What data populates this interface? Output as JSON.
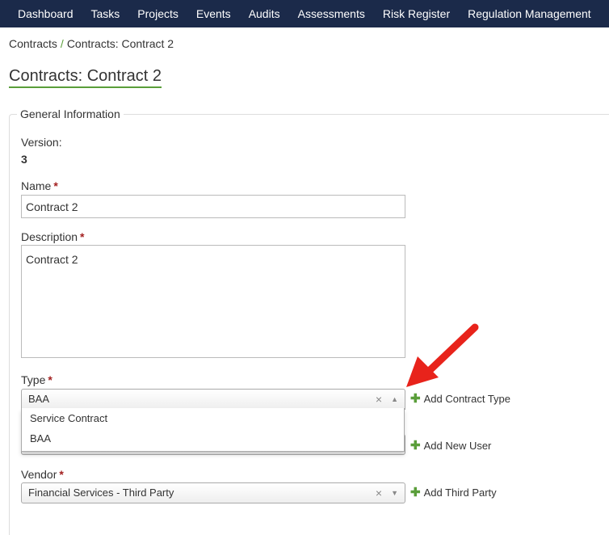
{
  "nav": {
    "items": [
      "Dashboard",
      "Tasks",
      "Projects",
      "Events",
      "Audits",
      "Assessments",
      "Risk Register",
      "Regulation Management"
    ]
  },
  "breadcrumb": {
    "root": "Contracts",
    "separator": "/",
    "current": "Contracts: Contract 2"
  },
  "page": {
    "title": "Contracts: Contract 2"
  },
  "section": {
    "legend": "General Information"
  },
  "version": {
    "label": "Version:",
    "value": "3"
  },
  "name": {
    "label": "Name",
    "value": "Contract 2",
    "required": "*"
  },
  "description": {
    "label": "Description",
    "value": "Contract 2",
    "required": "*"
  },
  "type": {
    "label": "Type",
    "required": "*",
    "selected": "BAA",
    "options": [
      "Service Contract",
      "BAA"
    ],
    "add_label": "Add Contract Type"
  },
  "user": {
    "add_label": "Add New User"
  },
  "vendor": {
    "label": "Vendor",
    "required": "*",
    "selected": "Financial Services - Third Party",
    "add_label": "Add Third Party"
  },
  "icons": {
    "clear": "×",
    "arrow_up": "▲",
    "arrow_down": "▼",
    "plus": "✚"
  },
  "colors": {
    "navbar": "#1b2a4a",
    "accent": "#5a9e3a",
    "required": "#a32020",
    "annotation": "#e8231b"
  }
}
